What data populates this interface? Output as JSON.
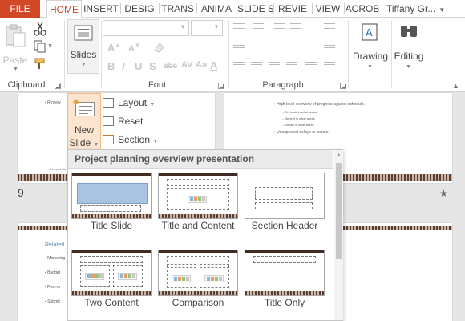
{
  "tabs": [
    {
      "label": "FILE",
      "state": "file"
    },
    {
      "label": "HOME",
      "state": "active"
    },
    {
      "label": "INSERT",
      "state": "normal"
    },
    {
      "label": "DESIG",
      "state": "normal"
    },
    {
      "label": "TRANS",
      "state": "normal"
    },
    {
      "label": "ANIMA",
      "state": "normal"
    },
    {
      "label": "SLIDE S",
      "state": "normal"
    },
    {
      "label": "REVIE",
      "state": "normal"
    },
    {
      "label": "VIEW",
      "state": "normal"
    },
    {
      "label": "ACROB",
      "state": "normal"
    }
  ],
  "user": {
    "name": "Tiffany Gr..."
  },
  "ribbon": {
    "clipboard": {
      "paste_label": "Paste",
      "group_label": "Clipboard"
    },
    "slides": {
      "slides_label": "Slides"
    },
    "font": {
      "group_label": "Font",
      "bold": "B",
      "italic": "I",
      "underline": "U",
      "strike": "S",
      "font_size_up": "A",
      "char_spacing": "AV",
      "change_case": "Aa",
      "font_color": "A"
    },
    "paragraph": {
      "group_label": "Paragraph"
    },
    "drawing": {
      "label": "Drawing"
    },
    "editing": {
      "label": "Editing"
    }
  },
  "slides_menu": {
    "new_slide": {
      "line1": "New",
      "line2": "Slide"
    },
    "layout": "Layout",
    "reset": "Reset",
    "section": "Section"
  },
  "layout_gallery": {
    "title": "Project planning overview presentation",
    "layouts": [
      "Title Slide",
      "Title and Content",
      "Section Header",
      "Two Content",
      "Comparison",
      "Title Only"
    ]
  },
  "slides_pane": {
    "slide_number": "9",
    "right_slide_bullets": [
      "High-level overview of progress against schedule.",
      "On track in what areas",
      "Behind in what areas",
      "Ahead in what areas",
      "Unexpected delays or issues."
    ],
    "left_slide_heading": "Related",
    "left_slide_bullets": [
      "Marketing",
      "Budget",
      "Post-m",
      "Submit"
    ]
  },
  "colors": {
    "accent": "#d24726",
    "highlight": "#fde4ce",
    "stripe_dark": "#5a3e32"
  }
}
